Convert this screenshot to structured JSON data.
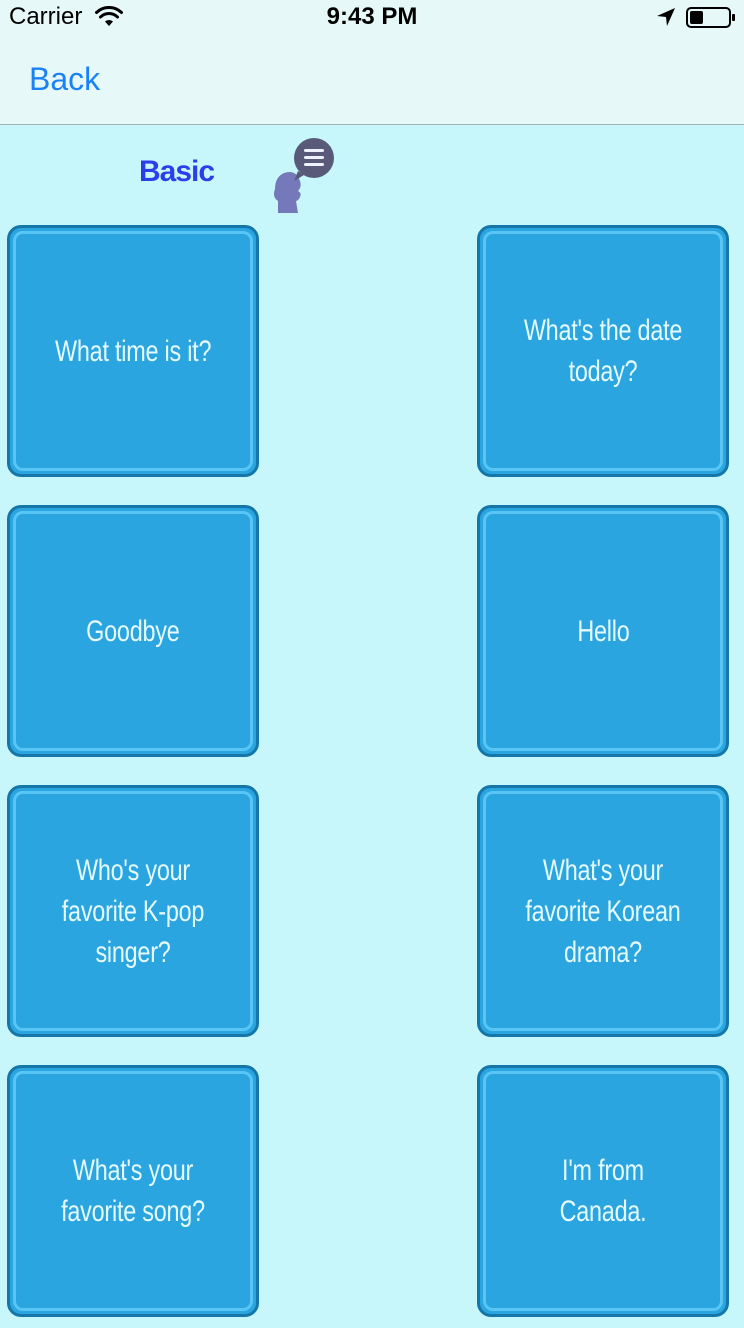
{
  "status_bar": {
    "carrier": "Carrier",
    "time": "9:43 PM",
    "icons": [
      "wifi-icon",
      "location-arrow-icon",
      "battery-icon"
    ]
  },
  "nav": {
    "back_label": "Back"
  },
  "header": {
    "category_title": "Basic",
    "speaker_icon": "speaking-head-menu-icon"
  },
  "cards": [
    {
      "label": "What time is it?"
    },
    {
      "label": "What's the date today?"
    },
    {
      "label": "Goodbye"
    },
    {
      "label": "Hello"
    },
    {
      "label": "Who's your favorite K-pop singer?"
    },
    {
      "label": "What's your favorite Korean drama?"
    },
    {
      "label": "What's your favorite song?"
    },
    {
      "label": "I'm from Canada."
    }
  ],
  "colors": {
    "background": "#c7f7fb",
    "nav_bar": "#e6f8f8",
    "accent_link": "#1a82f5",
    "title": "#2b3fe8",
    "card_fill": "#2aa5e0",
    "card_border": "#1577a9",
    "card_text": "#e5fbff"
  }
}
